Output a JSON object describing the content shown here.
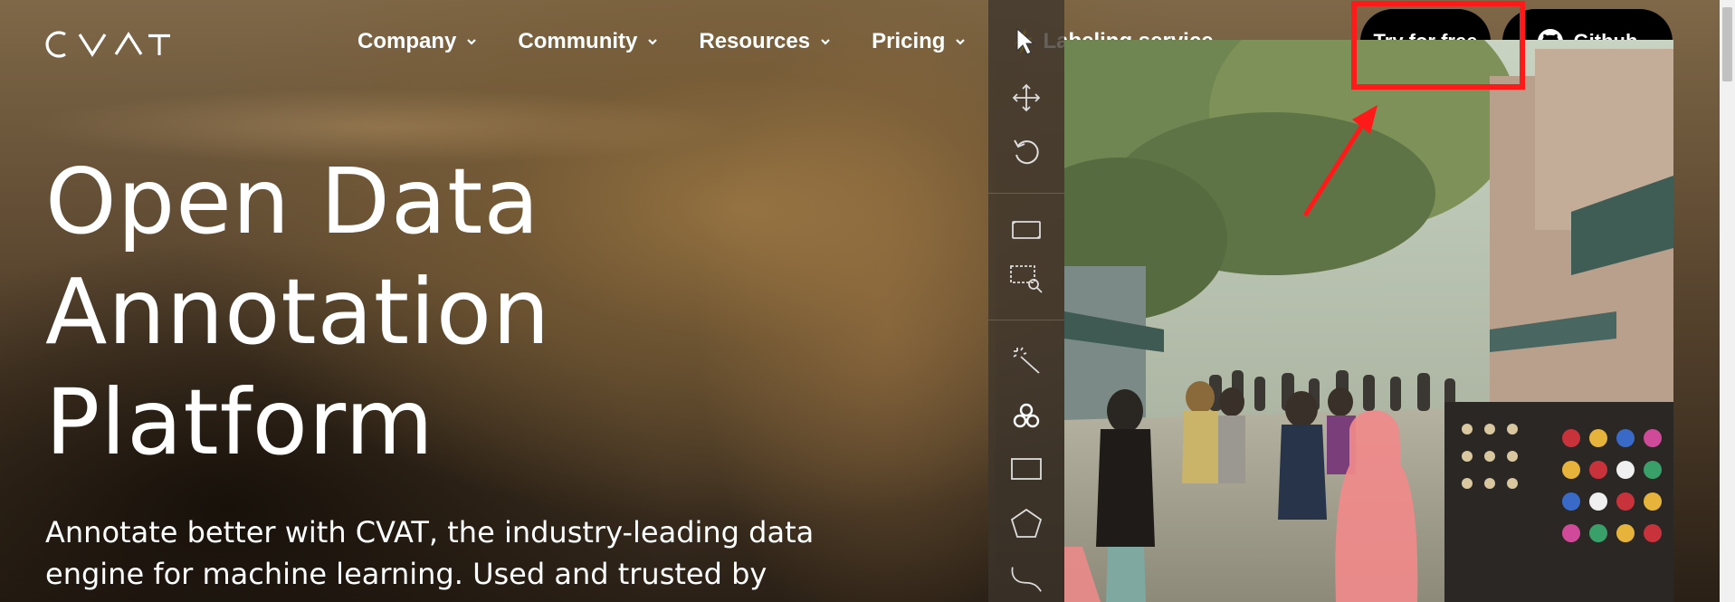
{
  "brand": {
    "logo_text": "CVAT"
  },
  "nav": {
    "items": [
      {
        "label": "Company",
        "has_dropdown": true
      },
      {
        "label": "Community",
        "has_dropdown": true
      },
      {
        "label": "Resources",
        "has_dropdown": true
      },
      {
        "label": "Pricing",
        "has_dropdown": true
      },
      {
        "label": "Labeling service",
        "icon": "lightning-bolt-icon"
      }
    ]
  },
  "header_buttons": {
    "try_label": "Try for free",
    "github_label": "Github"
  },
  "hero": {
    "title_lines": [
      "Open Data",
      "Annotation",
      "Platform"
    ],
    "subtitle_lines": [
      "Annotate better with CVAT, the industry-leading data",
      "engine for machine learning. Used and trusted by"
    ]
  },
  "toolbar": {
    "tools": [
      "cursor-icon",
      "move-icon",
      "rotate-icon",
      "fit-frame-icon",
      "zoom-region-icon",
      "magic-wand-icon",
      "ai-tools-icon",
      "rectangle-icon",
      "polygon-icon",
      "polyline-icon"
    ]
  },
  "colors": {
    "highlight": "#ff1a1a",
    "button_bg": "#000000",
    "bolt": "#f5c518",
    "mask": "#f08a8a"
  }
}
